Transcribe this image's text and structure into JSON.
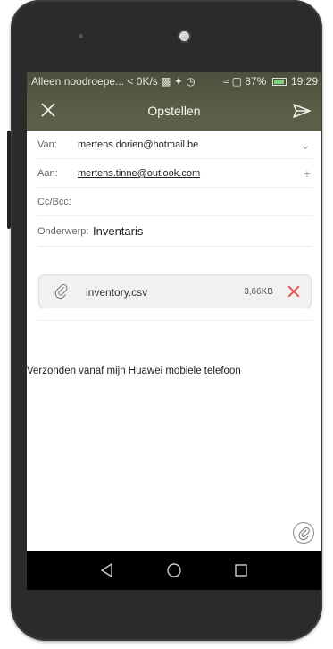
{
  "status_bar": {
    "carrier_text": "Alleen noodroepe...",
    "speed": "0K/s",
    "battery_percent": "87%",
    "time": "19:29"
  },
  "toolbar": {
    "close_icon": "close-icon",
    "title": "Opstellen",
    "send_icon": "send-icon"
  },
  "fields": {
    "from_label": "Van:",
    "from_value": "mertens.dorien@hotmail.be",
    "to_label": "Aan:",
    "to_value": "mertens.tinne@outlook.com",
    "to_action": "+",
    "ccbcc_label": "Cc/Bcc:",
    "subject_label": "Onderwerp:",
    "subject_value": "Inventaris"
  },
  "attachment": {
    "file_name": "inventory.csv",
    "file_size": "3,66KB"
  },
  "body": {
    "signature": "Verzonden vanaf mijn Huawei mobiele telefoon"
  },
  "colors": {
    "header_bg": "#5a5e47",
    "remove_red": "#e8453c"
  }
}
